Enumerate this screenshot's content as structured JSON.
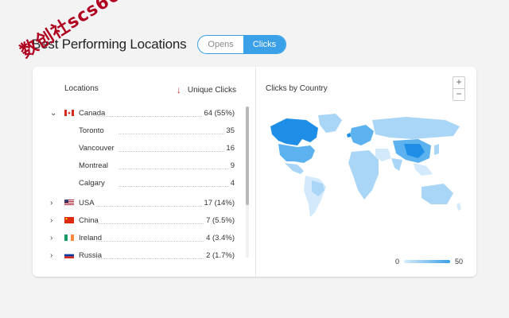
{
  "header": {
    "title": "Best Performing Locations",
    "toggle": {
      "opens": "Opens",
      "clicks": "Clicks",
      "active": "clicks"
    }
  },
  "watermark": "数创社scs66",
  "list": {
    "locations_label": "Locations",
    "unique_clicks_label": "Unique Clicks",
    "sort_icon": "arrow-down-icon",
    "countries": [
      {
        "name": "Canada",
        "value": "64 (55%)",
        "expanded": true,
        "cities": [
          {
            "name": "Toronto",
            "value": "35"
          },
          {
            "name": "Vancouver",
            "value": "16"
          },
          {
            "name": "Montreal",
            "value": "9"
          },
          {
            "name": "Calgary",
            "value": "4"
          }
        ]
      },
      {
        "name": "USA",
        "value": "17 (14%)",
        "expanded": false
      },
      {
        "name": "China",
        "value": "7 (5.5%)",
        "expanded": false
      },
      {
        "name": "Ireland",
        "value": "4 (3.4%)",
        "expanded": false
      },
      {
        "name": "Russia",
        "value": "2 (1.7%)",
        "expanded": false
      }
    ]
  },
  "map": {
    "title": "Clicks by Country",
    "zoom_in": "+",
    "zoom_out": "−",
    "legend_min": "0",
    "legend_max": "50",
    "colors": {
      "high": "#1f8ee6",
      "mid": "#5cb2ef",
      "low": "#a9d6f6",
      "lowest": "#d2eafb"
    }
  },
  "colors": {
    "accent": "#3aa0e8",
    "sort_arrow": "#c0392b"
  }
}
